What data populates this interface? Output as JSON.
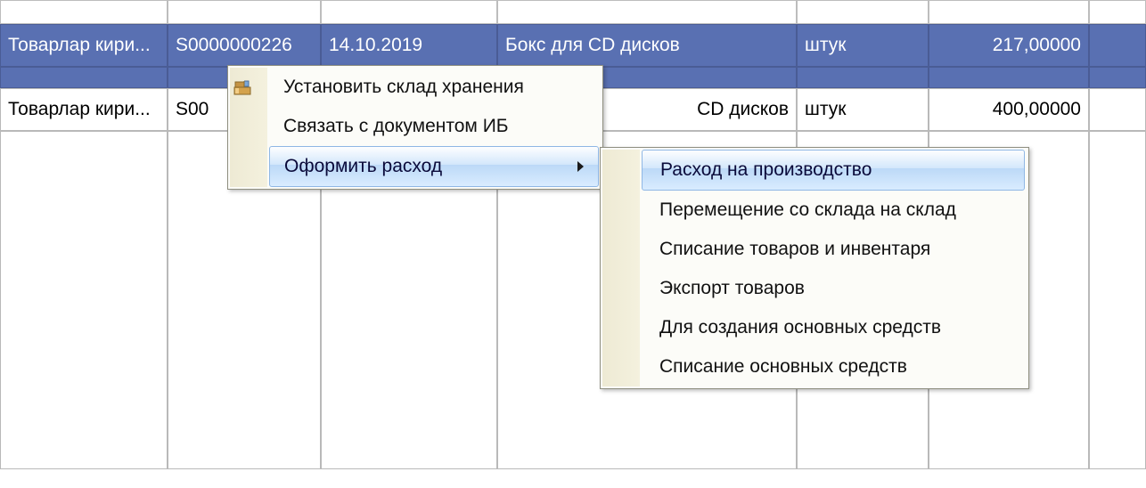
{
  "grid": {
    "rows": [
      {
        "type": "Товарлар кири...",
        "doc": "S0000000226",
        "date": "14.10.2019",
        "item": "Бокс для CD дисков",
        "unit": "штук",
        "qty": "217,00000",
        "selected": true
      },
      {
        "type": "Товарлар кири...",
        "doc": "S00",
        "date": "",
        "item": " CD дисков",
        "unit": "штук",
        "qty": "400,00000",
        "selected": false
      }
    ]
  },
  "context_menu": {
    "items": [
      {
        "label": "Установить склад хранения",
        "icon": "warehouse-icon"
      },
      {
        "label": "Связать с документом ИБ",
        "icon": null
      },
      {
        "label": "Оформить расход",
        "icon": null,
        "submenu": true,
        "highlight": true
      }
    ]
  },
  "submenu": {
    "items": [
      {
        "label": "Расход на производство",
        "highlight": true
      },
      {
        "label": "Перемещение со склада на склад"
      },
      {
        "label": "Списание товаров и инвентаря"
      },
      {
        "label": "Экспорт товаров"
      },
      {
        "label": "Для создания основных средств"
      },
      {
        "label": "Списание основных средств"
      }
    ]
  }
}
